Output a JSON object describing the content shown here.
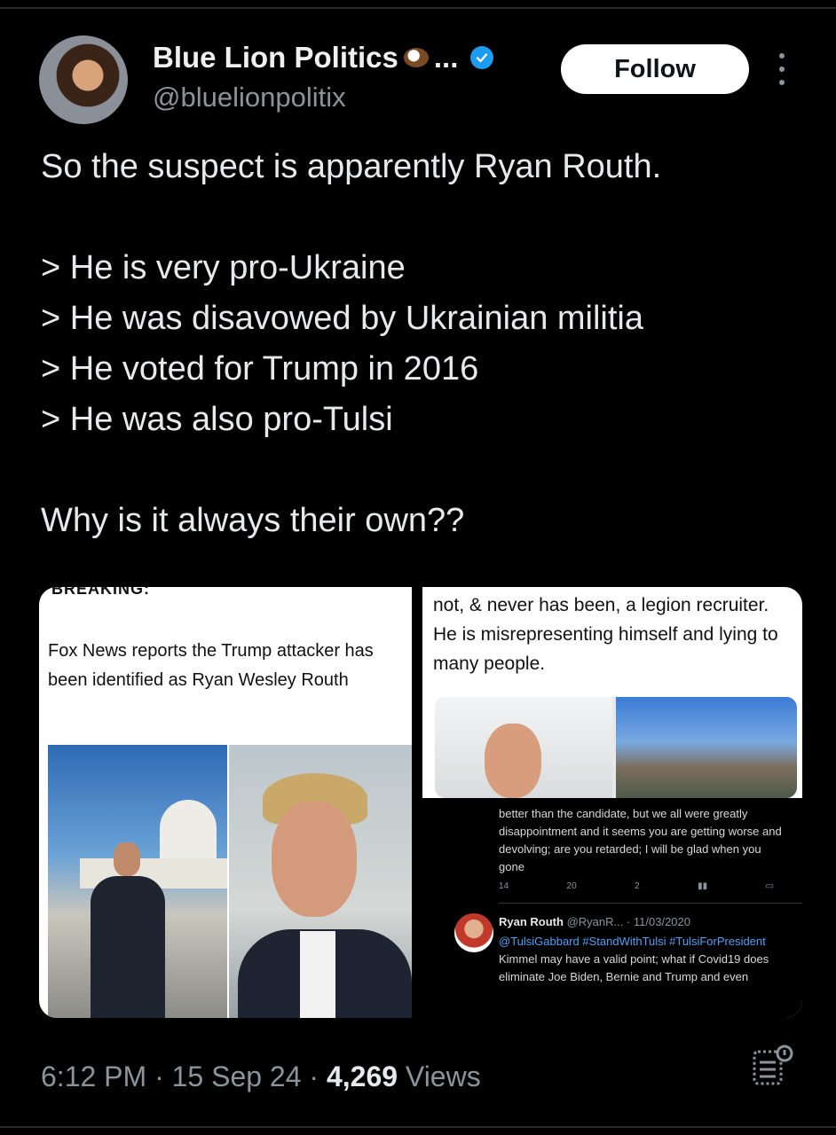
{
  "post": {
    "display_name": "Blue Lion Politics",
    "name_truncation": "...",
    "handle": "@bluelionpolitix",
    "follow_label": "Follow",
    "text_lines": [
      "So the suspect is apparently Ryan Routh.",
      "",
      "> He is very pro-Ukraine",
      "> He was disavowed by Ukrainian militia",
      "> He voted for Trump in 2016",
      "> He was also pro-Tulsi",
      "",
      "Why is it always their own??"
    ],
    "time": "6:12 PM",
    "date": "15 Sep 24",
    "views_count": "4,269",
    "views_label": "Views"
  },
  "media": {
    "left": {
      "header_cutoff": "BREAKING:",
      "text": "Fox News reports the Trump attacker has been identified as Ryan Wesley Routh"
    },
    "right": {
      "text": "not, & never has been, a legion recruiter. He is misrepresenting himself and lying to many people.",
      "reply1_text": "better than the candidate, but we all were greatly disappointment and it seems you are getting worse and devolving; are you retarded; I will be glad when you gone",
      "reply1_stats": [
        "14",
        "20",
        "2"
      ],
      "reply2_name": "Ryan Routh",
      "reply2_meta": "@RyanR... · 11/03/2020",
      "reply2_tags": "@TulsiGabbard #StandWithTulsi #TulsiForPresident",
      "reply2_text": "Kimmel may have a valid point; what if Covid19 does eliminate Joe Biden, Bernie and Trump and even"
    }
  },
  "icons": {
    "verified": "verified-badge-icon",
    "more": "more-options-icon",
    "analytics": "analytics-icon"
  },
  "colors": {
    "background": "#000000",
    "verified": "#1d9bf0",
    "follow_button": "#ffffff",
    "muted": "#8b949b"
  }
}
